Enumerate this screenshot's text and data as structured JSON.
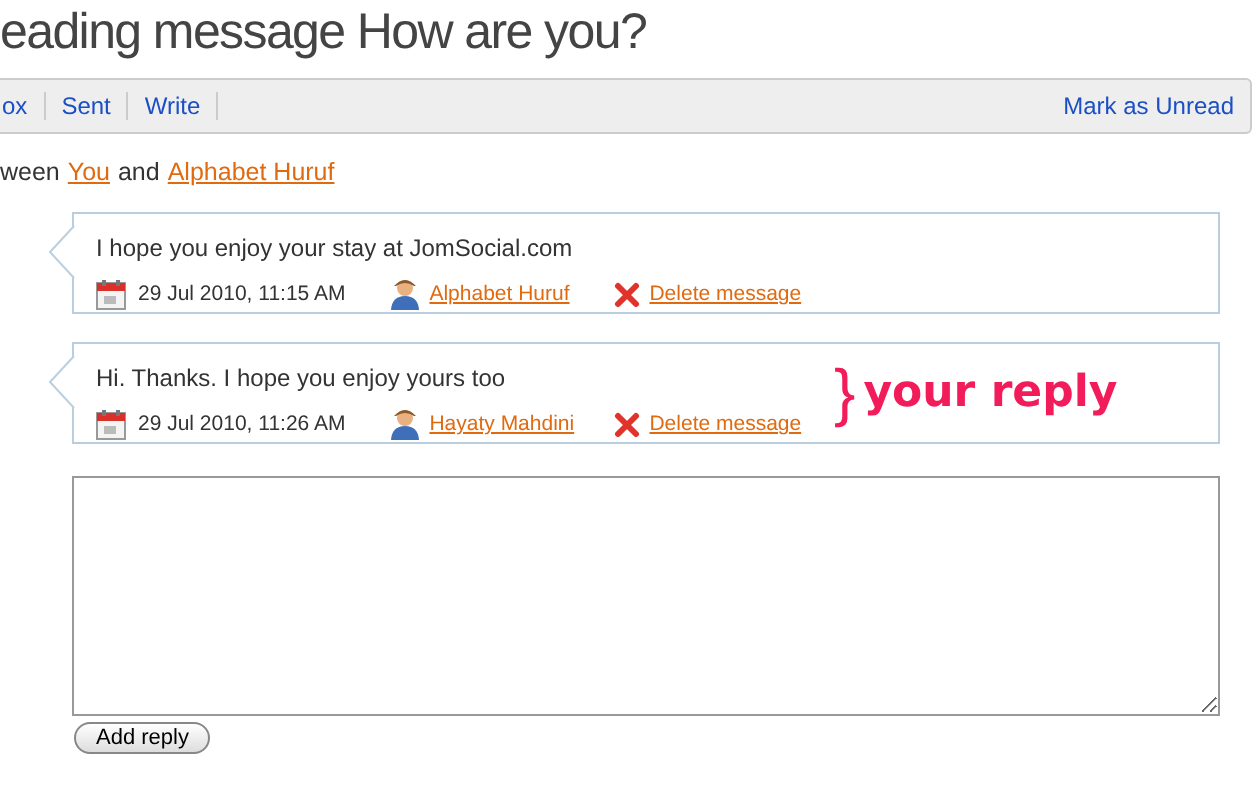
{
  "title": "eading message How are you?",
  "toolbar": {
    "links": [
      "ox",
      "Sent",
      "Write"
    ],
    "right_link": "Mark as Unread"
  },
  "participants": {
    "prefix": "ween",
    "first": "You",
    "joiner": "and",
    "second": "Alphabet Huruf"
  },
  "messages": [
    {
      "text": "I hope you enjoy your stay at JomSocial.com",
      "date": "29 Jul 2010, 11:15 AM",
      "author": "Alphabet Huruf",
      "delete": "Delete message"
    },
    {
      "text": "Hi. Thanks. I hope you enjoy yours too",
      "date": "29 Jul 2010, 11:26 AM",
      "author": "Hayaty Mahdini",
      "delete": "Delete message"
    }
  ],
  "annotation": {
    "brace": "}",
    "text": "your reply"
  },
  "reply_button": "Add reply"
}
